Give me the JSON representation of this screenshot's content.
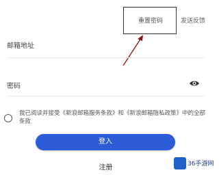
{
  "header": {
    "reset_password": "重置密码",
    "feedback": "发送反馈"
  },
  "form": {
    "email_label": "邮箱地址",
    "password_label": "密码"
  },
  "agreement": {
    "text": "我已阅读并接受《新浪邮箱服务条款》和《新浪邮箱隐私政策》中的全部条款"
  },
  "actions": {
    "login_label": "登入",
    "register_label": "注册"
  },
  "watermark": {
    "text": "36手游网"
  },
  "colors": {
    "primary": "#2e5bd8",
    "annotation": "#8b1a1a"
  }
}
